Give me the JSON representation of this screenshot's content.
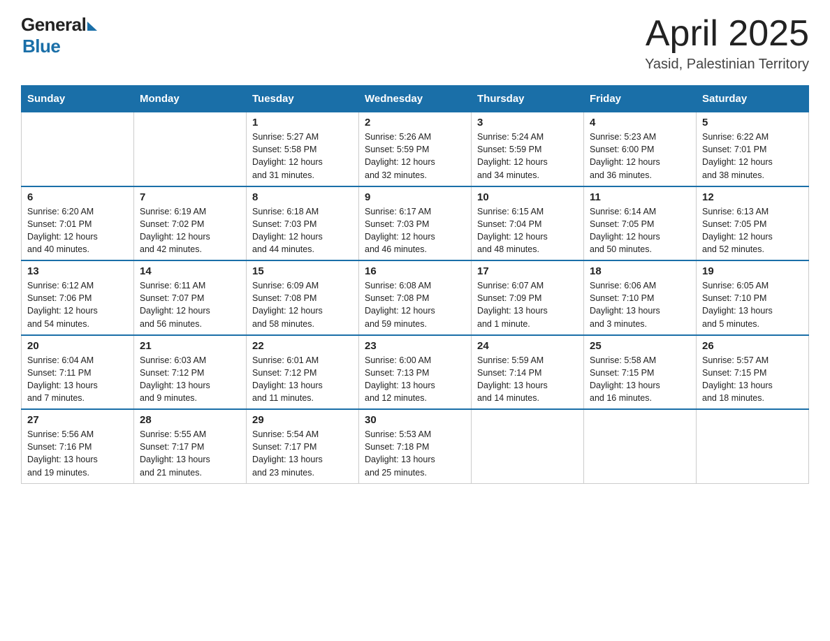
{
  "header": {
    "logo_general": "General",
    "logo_blue": "Blue",
    "month_title": "April 2025",
    "location": "Yasid, Palestinian Territory"
  },
  "days_of_week": [
    "Sunday",
    "Monday",
    "Tuesday",
    "Wednesday",
    "Thursday",
    "Friday",
    "Saturday"
  ],
  "weeks": [
    [
      {
        "day": "",
        "info": ""
      },
      {
        "day": "",
        "info": ""
      },
      {
        "day": "1",
        "info": "Sunrise: 5:27 AM\nSunset: 5:58 PM\nDaylight: 12 hours\nand 31 minutes."
      },
      {
        "day": "2",
        "info": "Sunrise: 5:26 AM\nSunset: 5:59 PM\nDaylight: 12 hours\nand 32 minutes."
      },
      {
        "day": "3",
        "info": "Sunrise: 5:24 AM\nSunset: 5:59 PM\nDaylight: 12 hours\nand 34 minutes."
      },
      {
        "day": "4",
        "info": "Sunrise: 5:23 AM\nSunset: 6:00 PM\nDaylight: 12 hours\nand 36 minutes."
      },
      {
        "day": "5",
        "info": "Sunrise: 6:22 AM\nSunset: 7:01 PM\nDaylight: 12 hours\nand 38 minutes."
      }
    ],
    [
      {
        "day": "6",
        "info": "Sunrise: 6:20 AM\nSunset: 7:01 PM\nDaylight: 12 hours\nand 40 minutes."
      },
      {
        "day": "7",
        "info": "Sunrise: 6:19 AM\nSunset: 7:02 PM\nDaylight: 12 hours\nand 42 minutes."
      },
      {
        "day": "8",
        "info": "Sunrise: 6:18 AM\nSunset: 7:03 PM\nDaylight: 12 hours\nand 44 minutes."
      },
      {
        "day": "9",
        "info": "Sunrise: 6:17 AM\nSunset: 7:03 PM\nDaylight: 12 hours\nand 46 minutes."
      },
      {
        "day": "10",
        "info": "Sunrise: 6:15 AM\nSunset: 7:04 PM\nDaylight: 12 hours\nand 48 minutes."
      },
      {
        "day": "11",
        "info": "Sunrise: 6:14 AM\nSunset: 7:05 PM\nDaylight: 12 hours\nand 50 minutes."
      },
      {
        "day": "12",
        "info": "Sunrise: 6:13 AM\nSunset: 7:05 PM\nDaylight: 12 hours\nand 52 minutes."
      }
    ],
    [
      {
        "day": "13",
        "info": "Sunrise: 6:12 AM\nSunset: 7:06 PM\nDaylight: 12 hours\nand 54 minutes."
      },
      {
        "day": "14",
        "info": "Sunrise: 6:11 AM\nSunset: 7:07 PM\nDaylight: 12 hours\nand 56 minutes."
      },
      {
        "day": "15",
        "info": "Sunrise: 6:09 AM\nSunset: 7:08 PM\nDaylight: 12 hours\nand 58 minutes."
      },
      {
        "day": "16",
        "info": "Sunrise: 6:08 AM\nSunset: 7:08 PM\nDaylight: 12 hours\nand 59 minutes."
      },
      {
        "day": "17",
        "info": "Sunrise: 6:07 AM\nSunset: 7:09 PM\nDaylight: 13 hours\nand 1 minute."
      },
      {
        "day": "18",
        "info": "Sunrise: 6:06 AM\nSunset: 7:10 PM\nDaylight: 13 hours\nand 3 minutes."
      },
      {
        "day": "19",
        "info": "Sunrise: 6:05 AM\nSunset: 7:10 PM\nDaylight: 13 hours\nand 5 minutes."
      }
    ],
    [
      {
        "day": "20",
        "info": "Sunrise: 6:04 AM\nSunset: 7:11 PM\nDaylight: 13 hours\nand 7 minutes."
      },
      {
        "day": "21",
        "info": "Sunrise: 6:03 AM\nSunset: 7:12 PM\nDaylight: 13 hours\nand 9 minutes."
      },
      {
        "day": "22",
        "info": "Sunrise: 6:01 AM\nSunset: 7:12 PM\nDaylight: 13 hours\nand 11 minutes."
      },
      {
        "day": "23",
        "info": "Sunrise: 6:00 AM\nSunset: 7:13 PM\nDaylight: 13 hours\nand 12 minutes."
      },
      {
        "day": "24",
        "info": "Sunrise: 5:59 AM\nSunset: 7:14 PM\nDaylight: 13 hours\nand 14 minutes."
      },
      {
        "day": "25",
        "info": "Sunrise: 5:58 AM\nSunset: 7:15 PM\nDaylight: 13 hours\nand 16 minutes."
      },
      {
        "day": "26",
        "info": "Sunrise: 5:57 AM\nSunset: 7:15 PM\nDaylight: 13 hours\nand 18 minutes."
      }
    ],
    [
      {
        "day": "27",
        "info": "Sunrise: 5:56 AM\nSunset: 7:16 PM\nDaylight: 13 hours\nand 19 minutes."
      },
      {
        "day": "28",
        "info": "Sunrise: 5:55 AM\nSunset: 7:17 PM\nDaylight: 13 hours\nand 21 minutes."
      },
      {
        "day": "29",
        "info": "Sunrise: 5:54 AM\nSunset: 7:17 PM\nDaylight: 13 hours\nand 23 minutes."
      },
      {
        "day": "30",
        "info": "Sunrise: 5:53 AM\nSunset: 7:18 PM\nDaylight: 13 hours\nand 25 minutes."
      },
      {
        "day": "",
        "info": ""
      },
      {
        "day": "",
        "info": ""
      },
      {
        "day": "",
        "info": ""
      }
    ]
  ]
}
